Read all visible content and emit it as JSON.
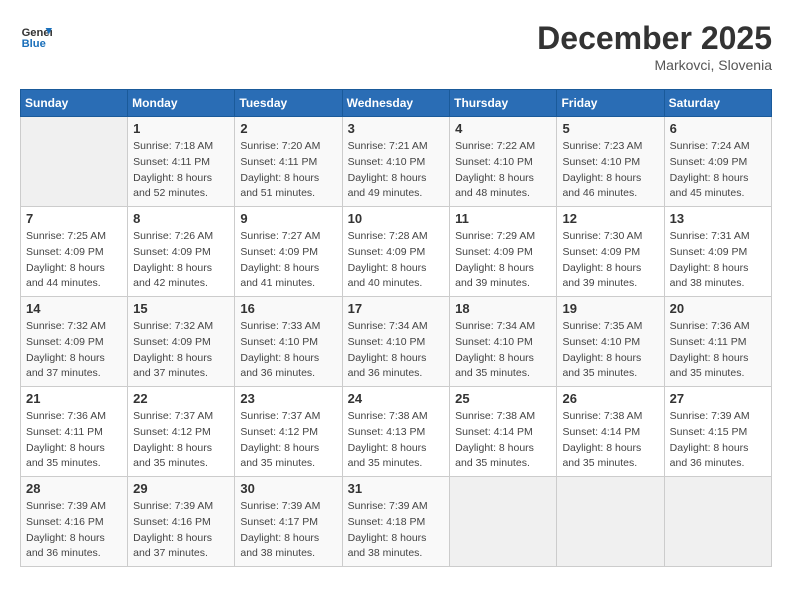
{
  "header": {
    "logo_line1": "General",
    "logo_line2": "Blue",
    "month": "December 2025",
    "location": "Markovci, Slovenia"
  },
  "weekdays": [
    "Sunday",
    "Monday",
    "Tuesday",
    "Wednesday",
    "Thursday",
    "Friday",
    "Saturday"
  ],
  "weeks": [
    [
      {
        "day": "",
        "info": ""
      },
      {
        "day": "1",
        "info": "Sunrise: 7:18 AM\nSunset: 4:11 PM\nDaylight: 8 hours\nand 52 minutes."
      },
      {
        "day": "2",
        "info": "Sunrise: 7:20 AM\nSunset: 4:11 PM\nDaylight: 8 hours\nand 51 minutes."
      },
      {
        "day": "3",
        "info": "Sunrise: 7:21 AM\nSunset: 4:10 PM\nDaylight: 8 hours\nand 49 minutes."
      },
      {
        "day": "4",
        "info": "Sunrise: 7:22 AM\nSunset: 4:10 PM\nDaylight: 8 hours\nand 48 minutes."
      },
      {
        "day": "5",
        "info": "Sunrise: 7:23 AM\nSunset: 4:10 PM\nDaylight: 8 hours\nand 46 minutes."
      },
      {
        "day": "6",
        "info": "Sunrise: 7:24 AM\nSunset: 4:09 PM\nDaylight: 8 hours\nand 45 minutes."
      }
    ],
    [
      {
        "day": "7",
        "info": "Sunrise: 7:25 AM\nSunset: 4:09 PM\nDaylight: 8 hours\nand 44 minutes."
      },
      {
        "day": "8",
        "info": "Sunrise: 7:26 AM\nSunset: 4:09 PM\nDaylight: 8 hours\nand 42 minutes."
      },
      {
        "day": "9",
        "info": "Sunrise: 7:27 AM\nSunset: 4:09 PM\nDaylight: 8 hours\nand 41 minutes."
      },
      {
        "day": "10",
        "info": "Sunrise: 7:28 AM\nSunset: 4:09 PM\nDaylight: 8 hours\nand 40 minutes."
      },
      {
        "day": "11",
        "info": "Sunrise: 7:29 AM\nSunset: 4:09 PM\nDaylight: 8 hours\nand 39 minutes."
      },
      {
        "day": "12",
        "info": "Sunrise: 7:30 AM\nSunset: 4:09 PM\nDaylight: 8 hours\nand 39 minutes."
      },
      {
        "day": "13",
        "info": "Sunrise: 7:31 AM\nSunset: 4:09 PM\nDaylight: 8 hours\nand 38 minutes."
      }
    ],
    [
      {
        "day": "14",
        "info": "Sunrise: 7:32 AM\nSunset: 4:09 PM\nDaylight: 8 hours\nand 37 minutes."
      },
      {
        "day": "15",
        "info": "Sunrise: 7:32 AM\nSunset: 4:09 PM\nDaylight: 8 hours\nand 37 minutes."
      },
      {
        "day": "16",
        "info": "Sunrise: 7:33 AM\nSunset: 4:10 PM\nDaylight: 8 hours\nand 36 minutes."
      },
      {
        "day": "17",
        "info": "Sunrise: 7:34 AM\nSunset: 4:10 PM\nDaylight: 8 hours\nand 36 minutes."
      },
      {
        "day": "18",
        "info": "Sunrise: 7:34 AM\nSunset: 4:10 PM\nDaylight: 8 hours\nand 35 minutes."
      },
      {
        "day": "19",
        "info": "Sunrise: 7:35 AM\nSunset: 4:10 PM\nDaylight: 8 hours\nand 35 minutes."
      },
      {
        "day": "20",
        "info": "Sunrise: 7:36 AM\nSunset: 4:11 PM\nDaylight: 8 hours\nand 35 minutes."
      }
    ],
    [
      {
        "day": "21",
        "info": "Sunrise: 7:36 AM\nSunset: 4:11 PM\nDaylight: 8 hours\nand 35 minutes."
      },
      {
        "day": "22",
        "info": "Sunrise: 7:37 AM\nSunset: 4:12 PM\nDaylight: 8 hours\nand 35 minutes."
      },
      {
        "day": "23",
        "info": "Sunrise: 7:37 AM\nSunset: 4:12 PM\nDaylight: 8 hours\nand 35 minutes."
      },
      {
        "day": "24",
        "info": "Sunrise: 7:38 AM\nSunset: 4:13 PM\nDaylight: 8 hours\nand 35 minutes."
      },
      {
        "day": "25",
        "info": "Sunrise: 7:38 AM\nSunset: 4:14 PM\nDaylight: 8 hours\nand 35 minutes."
      },
      {
        "day": "26",
        "info": "Sunrise: 7:38 AM\nSunset: 4:14 PM\nDaylight: 8 hours\nand 35 minutes."
      },
      {
        "day": "27",
        "info": "Sunrise: 7:39 AM\nSunset: 4:15 PM\nDaylight: 8 hours\nand 36 minutes."
      }
    ],
    [
      {
        "day": "28",
        "info": "Sunrise: 7:39 AM\nSunset: 4:16 PM\nDaylight: 8 hours\nand 36 minutes."
      },
      {
        "day": "29",
        "info": "Sunrise: 7:39 AM\nSunset: 4:16 PM\nDaylight: 8 hours\nand 37 minutes."
      },
      {
        "day": "30",
        "info": "Sunrise: 7:39 AM\nSunset: 4:17 PM\nDaylight: 8 hours\nand 38 minutes."
      },
      {
        "day": "31",
        "info": "Sunrise: 7:39 AM\nSunset: 4:18 PM\nDaylight: 8 hours\nand 38 minutes."
      },
      {
        "day": "",
        "info": ""
      },
      {
        "day": "",
        "info": ""
      },
      {
        "day": "",
        "info": ""
      }
    ]
  ]
}
